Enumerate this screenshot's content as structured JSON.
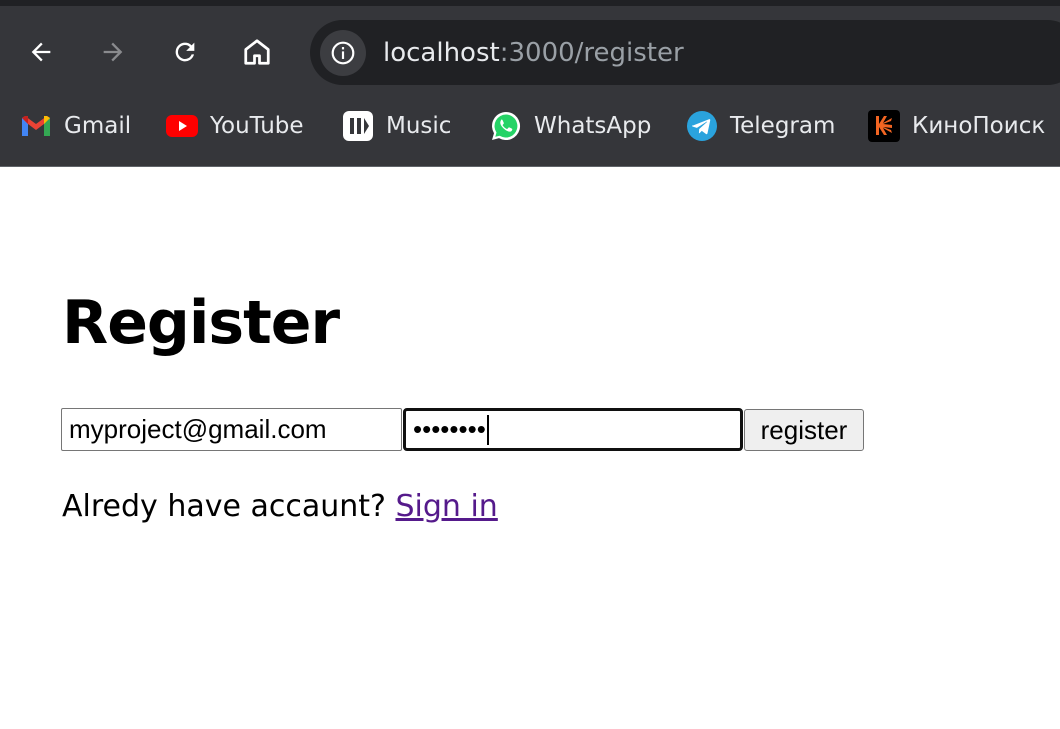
{
  "browser": {
    "url_host": "localhost",
    "url_rest": ":3000/register",
    "bookmarks": [
      {
        "label": "Gmail",
        "icon": "gmail-icon"
      },
      {
        "label": "YouTube",
        "icon": "youtube-icon"
      },
      {
        "label": "Music",
        "icon": "music-icon"
      },
      {
        "label": "WhatsApp",
        "icon": "whatsapp-icon"
      },
      {
        "label": "Telegram",
        "icon": "telegram-icon"
      },
      {
        "label": "КиноПоиск",
        "icon": "kinopoisk-icon"
      }
    ],
    "colors": {
      "chrome_bg": "#35363a",
      "omnibox_bg": "#202124",
      "text": "#e8eaed",
      "muted": "#9aa0a6"
    }
  },
  "page": {
    "title": "Register",
    "email_value": "myproject@gmail.com",
    "password_mask": "••••••••",
    "register_label": "register",
    "signin_prompt": "Alredy have accaunt? ",
    "signin_link": "Sign in",
    "colors": {
      "link": "#551a8b"
    }
  }
}
